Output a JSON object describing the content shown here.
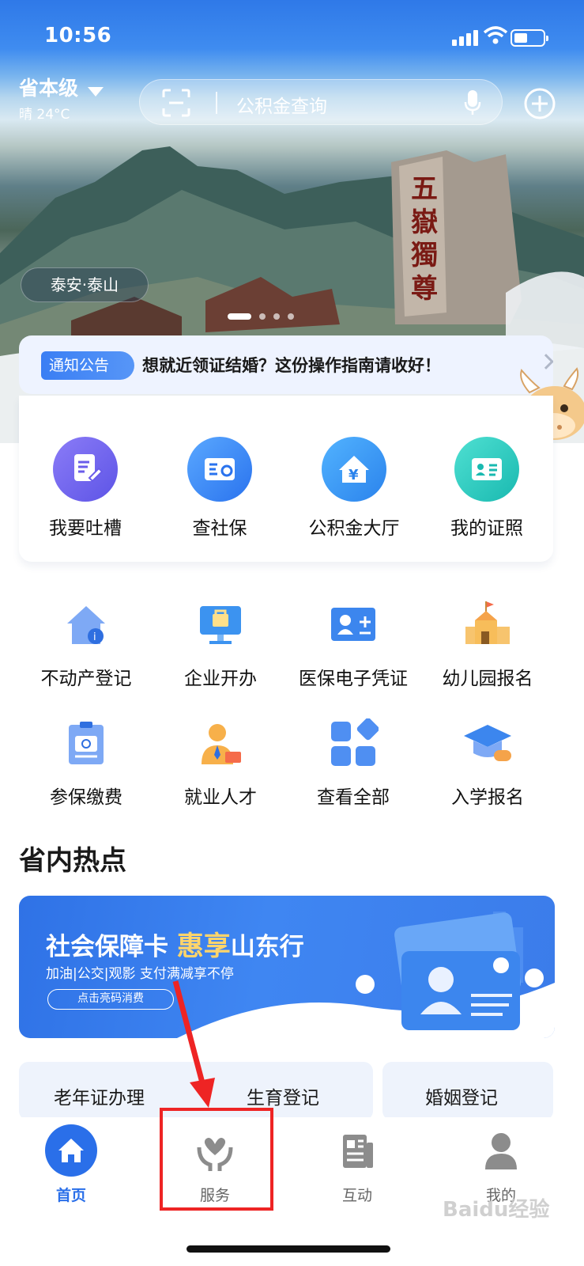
{
  "status_bar": {
    "time": "10:56"
  },
  "header": {
    "region": "省本级",
    "weather": "晴 24°C",
    "search_placeholder": "公积金查询"
  },
  "hero": {
    "location_tag": "泰安·泰山"
  },
  "notice": {
    "badge": "通知公告",
    "text": "想就近领证结婚？这份操作指南请收好！"
  },
  "quick_actions": [
    {
      "label": "我要吐槽",
      "icon": "document-edit-icon"
    },
    {
      "label": "查社保",
      "icon": "social-security-card-icon"
    },
    {
      "label": "公积金大厅",
      "icon": "housing-fund-house-icon"
    },
    {
      "label": "我的证照",
      "icon": "id-card-icon"
    }
  ],
  "services": [
    {
      "label": "不动产登记",
      "icon": "property-house-icon"
    },
    {
      "label": "企业开办",
      "icon": "business-briefcase-icon"
    },
    {
      "label": "医保电子凭证",
      "icon": "medical-insurance-card-icon"
    },
    {
      "label": "幼儿园报名",
      "icon": "kindergarten-building-icon"
    },
    {
      "label": "参保缴费",
      "icon": "insurance-payment-icon"
    },
    {
      "label": "就业人才",
      "icon": "employment-person-icon"
    },
    {
      "label": "查看全部",
      "icon": "all-apps-grid-icon"
    },
    {
      "label": "入学报名",
      "icon": "graduation-cap-icon"
    }
  ],
  "hot": {
    "title": "省内热点",
    "banner": {
      "title_prefix": "社会保障卡",
      "title_highlight": "惠享",
      "title_suffix": "山东行",
      "subtitle": "加油|公交|观影  支付满减享不停",
      "button": "点击亮码消费"
    },
    "chips": [
      "老年证办理",
      "生育登记",
      "婚姻登记"
    ]
  },
  "tabbar": [
    {
      "label": "首页",
      "icon": "home-icon",
      "active": true
    },
    {
      "label": "服务",
      "icon": "service-heart-hand-icon",
      "active": false
    },
    {
      "label": "互动",
      "icon": "interaction-news-icon",
      "active": false
    },
    {
      "label": "我的",
      "icon": "profile-person-icon",
      "active": false
    }
  ],
  "watermark": "Baidu经验",
  "colors": {
    "accent": "#2a6fe9",
    "annotation": "#ee2424",
    "highlight": "#ffd56a"
  }
}
